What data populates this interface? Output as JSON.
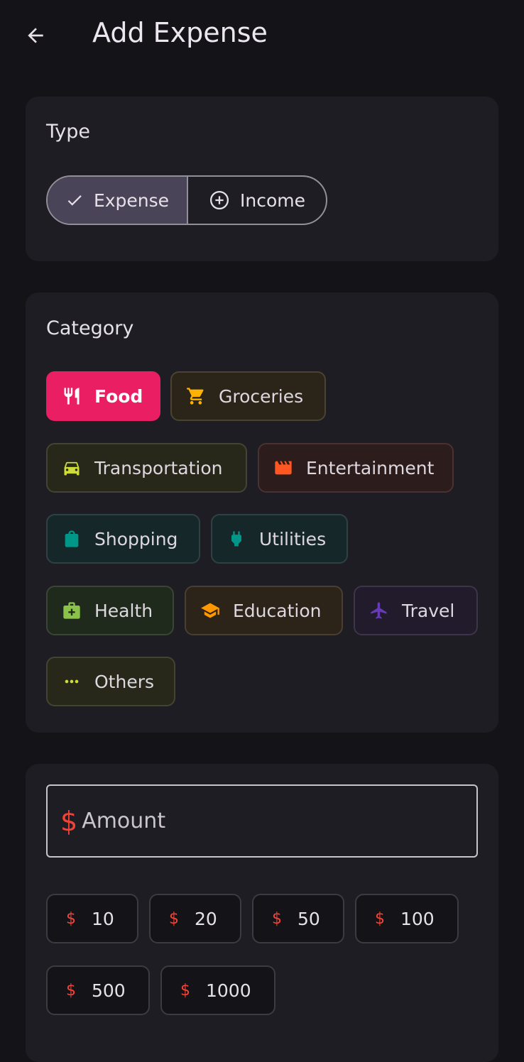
{
  "header": {
    "title": "Add Expense",
    "back_icon": "arrow-back-icon"
  },
  "type_card": {
    "label": "Type",
    "options": [
      {
        "label": "Expense",
        "icon": "check-icon",
        "selected": true
      },
      {
        "label": "Income",
        "icon": "add-circle-icon",
        "selected": false
      }
    ]
  },
  "category_card": {
    "label": "Category",
    "chips": [
      {
        "label": "Food",
        "icon": "restaurant-icon",
        "color": "#e91e63",
        "selected": true
      },
      {
        "label": "Groceries",
        "icon": "shopping-cart-icon",
        "color": "#ffb300"
      },
      {
        "label": "Transportation",
        "icon": "car-icon",
        "color": "#cddc39"
      },
      {
        "label": "Entertainment",
        "icon": "movie-icon",
        "color": "#ff5722"
      },
      {
        "label": "Shopping",
        "icon": "shopping-bag-icon",
        "color": "#009688"
      },
      {
        "label": "Utilities",
        "icon": "power-plug-icon",
        "color": "#009688"
      },
      {
        "label": "Health",
        "icon": "medical-bag-icon",
        "color": "#8bc34a"
      },
      {
        "label": "Education",
        "icon": "school-icon",
        "color": "#ff9800"
      },
      {
        "label": "Travel",
        "icon": "airplane-icon",
        "color": "#673ab7"
      },
      {
        "label": "Others",
        "icon": "more-horiz-icon",
        "color": "#cddc39"
      }
    ]
  },
  "amount_card": {
    "currency_symbol": "$",
    "placeholder": "Amount",
    "quick_amounts": [
      "10",
      "20",
      "50",
      "100",
      "500",
      "1000"
    ]
  }
}
